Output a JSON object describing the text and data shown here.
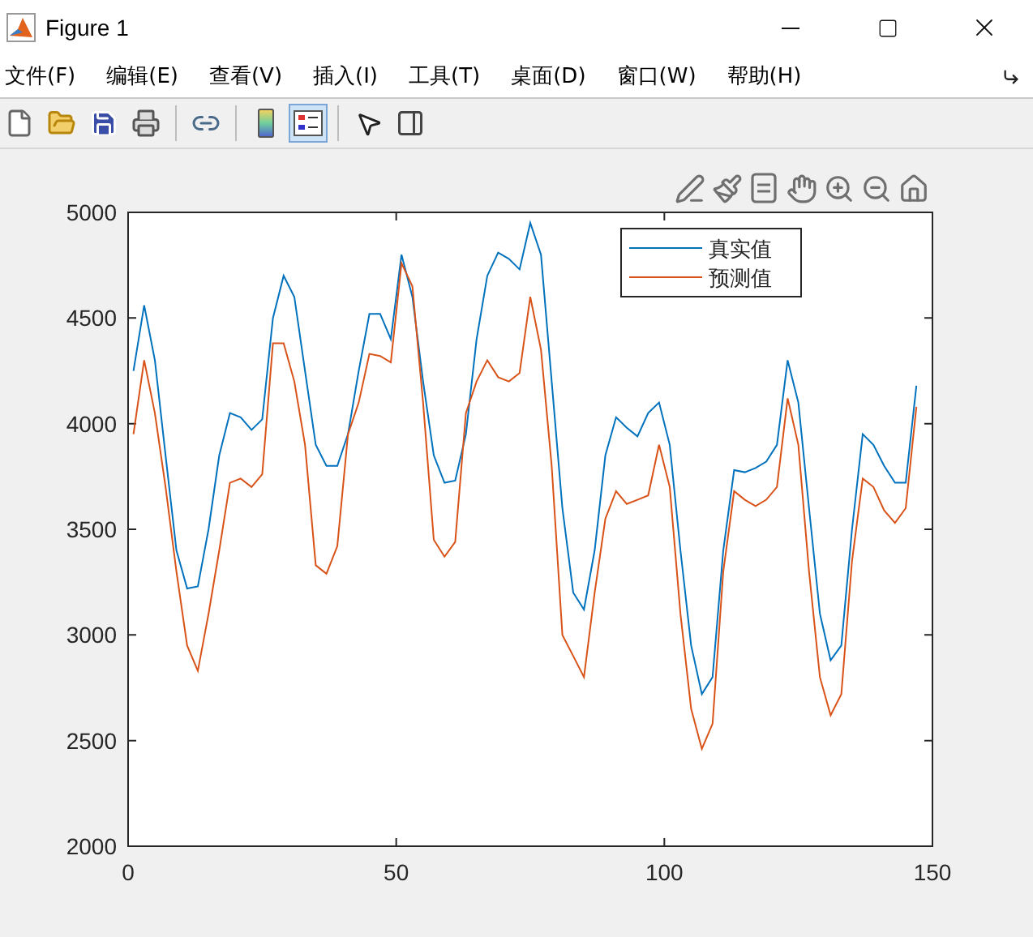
{
  "window": {
    "title": "Figure 1"
  },
  "menu": [
    "文件(F)",
    "编辑(E)",
    "查看(V)",
    "插入(I)",
    "工具(T)",
    "桌面(D)",
    "窗口(W)",
    "帮助(H)"
  ],
  "toolbar": [
    {
      "selected": false
    },
    {
      "selected": false
    },
    {
      "selected": false
    },
    {
      "selected": false
    },
    {
      "selected": false
    },
    {
      "selected": false
    },
    {
      "selected": true
    },
    {
      "selected": false
    },
    {
      "selected": false
    }
  ],
  "chart_data": {
    "type": "line",
    "legend": true,
    "xlim": [
      0,
      150
    ],
    "ylim": [
      2000,
      5000
    ],
    "xticks": [
      0,
      50,
      100,
      150
    ],
    "yticks": [
      2000,
      2500,
      3000,
      3500,
      4000,
      4500,
      5000
    ],
    "x": [
      1,
      3,
      5,
      7,
      9,
      11,
      13,
      15,
      17,
      19,
      21,
      23,
      25,
      27,
      29,
      31,
      33,
      35,
      37,
      39,
      41,
      43,
      45,
      47,
      49,
      51,
      53,
      55,
      57,
      59,
      61,
      63,
      65,
      67,
      69,
      71,
      73,
      75,
      77,
      79,
      81,
      83,
      85,
      87,
      89,
      91,
      93,
      95,
      97,
      99,
      101,
      103,
      105,
      107,
      109,
      111,
      113,
      115,
      117,
      119,
      121,
      123,
      125,
      127,
      129,
      131,
      133,
      135,
      137,
      139,
      141,
      143,
      145,
      147
    ],
    "series": [
      {
        "name": "真实值",
        "color": "#0072bd",
        "values": [
          4250,
          4560,
          4300,
          3850,
          3400,
          3220,
          3230,
          3500,
          3850,
          4050,
          4030,
          3970,
          4020,
          4500,
          4700,
          4600,
          4250,
          3900,
          3800,
          3800,
          3950,
          4250,
          4520,
          4520,
          4400,
          4800,
          4600,
          4200,
          3850,
          3720,
          3730,
          3950,
          4400,
          4700,
          4810,
          4780,
          4730,
          4950,
          4800,
          4200,
          3600,
          3200,
          3120,
          3400,
          3850,
          4030,
          3980,
          3940,
          4050,
          4100,
          3900,
          3400,
          2950,
          2720,
          2800,
          3400,
          3780,
          3770,
          3790,
          3820,
          3900,
          4300,
          4100,
          3600,
          3100,
          2880,
          2950,
          3500,
          3950,
          3900,
          3800,
          3720,
          3720,
          4180
        ]
      },
      {
        "name": "预测值",
        "color": "#d95319",
        "values": [
          3950,
          4300,
          4050,
          3700,
          3300,
          2950,
          2830,
          3100,
          3400,
          3720,
          3740,
          3700,
          3760,
          4380,
          4380,
          4200,
          3900,
          3330,
          3290,
          3420,
          3950,
          4100,
          4330,
          4320,
          4290,
          4760,
          4650,
          4100,
          3450,
          3370,
          3440,
          4050,
          4200,
          4300,
          4220,
          4200,
          4240,
          4600,
          4350,
          3800,
          3000,
          2900,
          2800,
          3200,
          3550,
          3680,
          3620,
          3640,
          3660,
          3900,
          3700,
          3100,
          2650,
          2460,
          2580,
          3300,
          3680,
          3640,
          3610,
          3640,
          3700,
          4120,
          3900,
          3300,
          2800,
          2620,
          2720,
          3350,
          3740,
          3700,
          3590,
          3530,
          3600,
          4080
        ]
      }
    ]
  }
}
